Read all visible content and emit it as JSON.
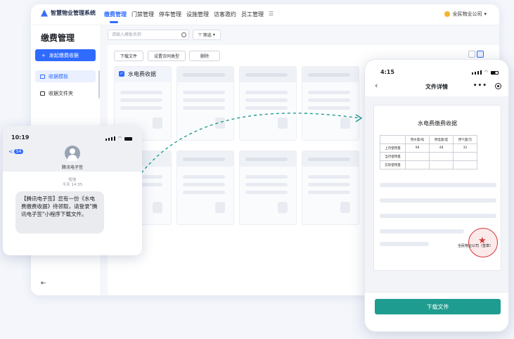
{
  "app": {
    "logo_text": "智慧物业管理系统",
    "nav": [
      "缴费管理",
      "门禁管理",
      "停车管理",
      "设施管理",
      "访客邀约",
      "员工管理"
    ],
    "nav_active_index": 0,
    "menu_icon": "hamburger-icon",
    "company": "全民物业公司",
    "accent": "#2f6bff"
  },
  "sidebar": {
    "title": "缴费管理",
    "new_button": "发起缴费收据",
    "items": [
      {
        "label": "收据模板",
        "active": true
      },
      {
        "label": "收据文件夹",
        "active": false
      }
    ]
  },
  "toolbar": {
    "search_placeholder": "请输入模板名称",
    "filter_label": "筛选",
    "buttons": [
      "下载文件",
      "设置合同类型",
      "删除"
    ]
  },
  "templates": {
    "first_title": "水电费收据"
  },
  "sms_phone": {
    "time": "10:19",
    "badge": "54",
    "sender": "腾讯电子签",
    "label": "短信",
    "timestamp": "今天 14:35",
    "message": "【腾讯电子签】您有一份《水电费缴费收据》待领取，请登录\"腾讯电子签\"小程序下载文件。"
  },
  "detail_phone": {
    "time": "4:15",
    "title": "文件详情",
    "more": "•••",
    "doc_title": "水电费缴费收据",
    "table": {
      "headers": [
        "",
        "用水量/吨",
        "用电量/度",
        "用气量/方"
      ],
      "rows": [
        [
          "上月使用量",
          "98",
          "48",
          "32"
        ],
        [
          "当月使用量",
          "",
          "",
          ""
        ],
        [
          "实际使用量",
          "",
          "",
          ""
        ]
      ]
    },
    "seal_caption": "全民物业公司（签章）",
    "download_button": "下载文件",
    "button_color": "#1e9c8f",
    "seal_color": "#d8363a"
  }
}
